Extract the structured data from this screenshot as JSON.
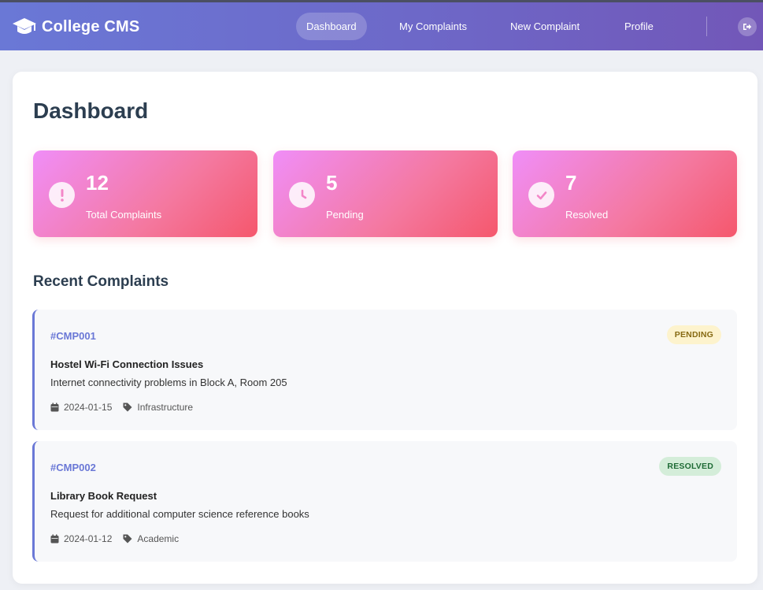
{
  "brand": {
    "name": "College CMS"
  },
  "nav": {
    "items": [
      {
        "label": "Dashboard",
        "active": true
      },
      {
        "label": "My Complaints",
        "active": false
      },
      {
        "label": "New Complaint",
        "active": false
      },
      {
        "label": "Profile",
        "active": false
      }
    ]
  },
  "page": {
    "title": "Dashboard"
  },
  "stats": [
    {
      "value": "12",
      "label": "Total Complaints",
      "icon": "exclamation-icon"
    },
    {
      "value": "5",
      "label": "Pending",
      "icon": "clock-icon"
    },
    {
      "value": "7",
      "label": "Resolved",
      "icon": "check-circle-icon"
    }
  ],
  "recent": {
    "title": "Recent Complaints",
    "items": [
      {
        "id": "#CMP001",
        "status": "PENDING",
        "title": "Hostel Wi-Fi Connection Issues",
        "description": "Internet connectivity problems in Block A, Room 205",
        "date": "2024-01-15",
        "category": "Infrastructure"
      },
      {
        "id": "#CMP002",
        "status": "RESOLVED",
        "title": "Library Book Request",
        "description": "Request for additional computer science reference books",
        "date": "2024-01-12",
        "category": "Academic"
      }
    ]
  },
  "colors": {
    "accent": "#6a78d6",
    "stat_gradient_start": "#f08ef8",
    "stat_gradient_end": "#f5576c",
    "pending_bg": "#fdf3cd",
    "resolved_bg": "#d4edd9"
  }
}
